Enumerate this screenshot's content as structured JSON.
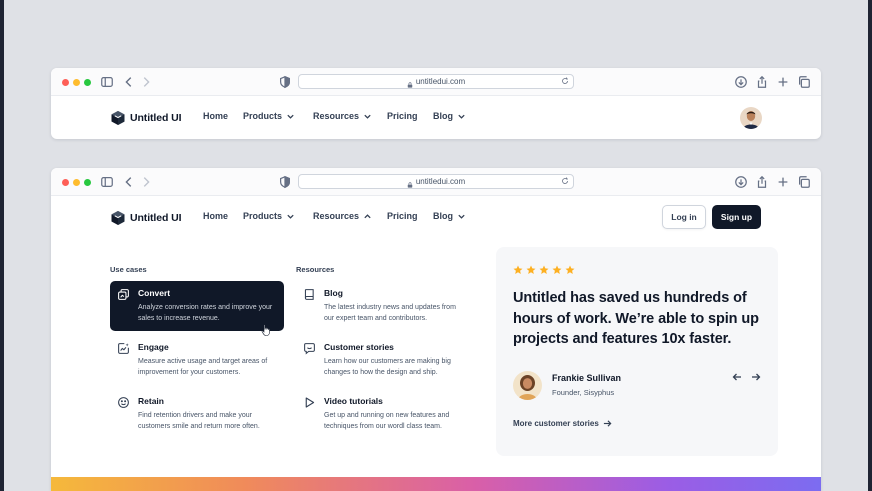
{
  "browser": {
    "url": "untitledui.com"
  },
  "brand": {
    "name": "Untitled UI"
  },
  "nav": {
    "home": "Home",
    "products": "Products",
    "resources": "Resources",
    "pricing": "Pricing",
    "blog": "Blog"
  },
  "auth": {
    "login": "Log in",
    "signup": "Sign up"
  },
  "menu": {
    "use_cases_heading": "Use cases",
    "resources_heading": "Resources",
    "use_cases": [
      {
        "title": "Convert",
        "desc": "Analyze conversion rates and improve your sales to increase revenue.",
        "icon": "convert-icon",
        "active": true
      },
      {
        "title": "Engage",
        "desc": "Measure active usage and target areas of improvement for your customers.",
        "icon": "engage-icon"
      },
      {
        "title": "Retain",
        "desc": "Find retention drivers and make your customers smile and return more often.",
        "icon": "smile-icon"
      }
    ],
    "resources": [
      {
        "title": "Blog",
        "desc": "The latest industry news and updates from our expert team and contributors.",
        "icon": "book-icon"
      },
      {
        "title": "Customer stories",
        "desc": "Learn how our customers are making big changes to how the design and ship.",
        "icon": "message-smile-icon"
      },
      {
        "title": "Video tutorials",
        "desc": "Get up and running on new features and techniques from our wordl class team.",
        "icon": "play-icon"
      }
    ]
  },
  "testimonial": {
    "rating": 5,
    "quote": "Untitled has saved us hundreds of hours of work. We’re able to spin up projects and features 10x faster.",
    "name": "Frankie Sullivan",
    "role": "Founder, Sisyphus",
    "more_link": "More customer stories"
  },
  "colors": {
    "primary": "#101828",
    "star": "#fdb022",
    "card_bg": "#f6f7f9"
  }
}
